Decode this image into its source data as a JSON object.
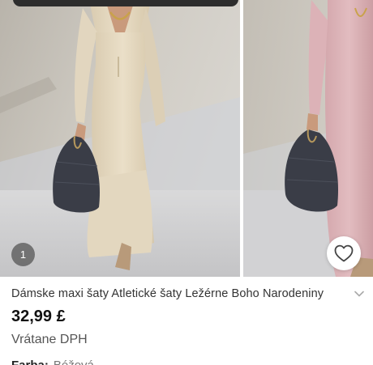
{
  "gallery": {
    "current_index": "1",
    "wishlist_icon": "heart-icon",
    "slides": [
      "beige-dress-photo",
      "pink-dress-photo"
    ]
  },
  "product": {
    "title": "Dámske maxi šaty Atletické šaty Ležérne Boho Narodeniny",
    "price": "32,99 £",
    "tax_note": "Vrátane DPH",
    "attribute_label": "Farba:",
    "attribute_value": "Béžová"
  },
  "colors": {
    "price_text": "#111111",
    "muted_text": "#555555",
    "badge_bg": "#505050"
  }
}
